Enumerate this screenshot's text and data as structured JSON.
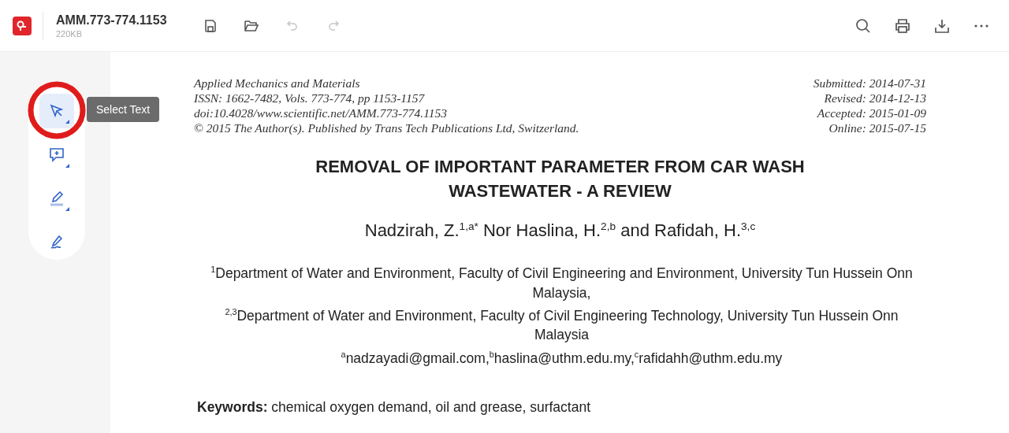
{
  "header": {
    "title": "AMM.773-774.1153",
    "file_size": "220KB",
    "left_actions": [
      {
        "kind": "save",
        "disabled": false
      },
      {
        "kind": "open",
        "disabled": false
      },
      {
        "kind": "undo",
        "disabled": true
      },
      {
        "kind": "redo",
        "disabled": true
      }
    ],
    "right_actions": [
      {
        "kind": "search"
      },
      {
        "kind": "print"
      },
      {
        "kind": "download"
      },
      {
        "kind": "more"
      }
    ]
  },
  "tools": [
    {
      "kind": "select",
      "selected": true,
      "submenu": true
    },
    {
      "kind": "comment",
      "selected": false,
      "submenu": true
    },
    {
      "kind": "highlight",
      "selected": false,
      "submenu": true
    },
    {
      "kind": "sign",
      "selected": false,
      "submenu": false
    }
  ],
  "tooltip": "Select Text",
  "document": {
    "journal_lines": [
      "Applied Mechanics and Materials",
      "ISSN: 1662-7482, Vols. 773-774, pp 1153-1157",
      "doi:10.4028/www.scientific.net/AMM.773-774.1153",
      "© 2015 The Author(s). Published by Trans Tech Publications Ltd, Switzerland."
    ],
    "dates": [
      "Submitted: 2014-07-31",
      "Revised: 2014-12-13",
      "Accepted: 2015-01-09",
      "Online: 2015-07-15"
    ],
    "title": "REMOVAL OF IMPORTANT PARAMETER FROM CAR WASH WASTEWATER - A REVIEW",
    "authors": "Nadzirah, Z.$^{1,a*}$ Nor Haslina, H.$^{2,b}$ and Rafidah, H.$^{3,c}$",
    "affiliations": [
      "$^{1}$Department of Water and Environment, Faculty of Civil Engineering and Environment, University Tun Hussein Onn Malaysia,",
      "$^{2,3}$Department of  Water and Environment, Faculty of Civil Engineering Technology, University Tun Hussein Onn Malaysia",
      "$^{a}$nadzayadi@gmail.com,$^{b}$haslina@uthm.edu.my,$^{c}$rafidahh@uthm.edu.my"
    ],
    "keywords_label": "Keywords:",
    "keywords": "chemical oxygen demand, oil and grease, surfactant"
  }
}
